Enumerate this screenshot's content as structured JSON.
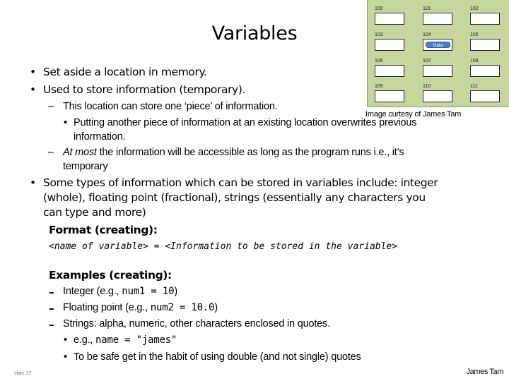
{
  "slide": {
    "title": "Variables",
    "bullets_top": [
      "Set aside a location in memory.",
      "Used to store information (temporary)."
    ],
    "sub1_a": "This location can store one ‘piece’ of information.",
    "sub1_a_child_line1": "Putting another piece of information at an existing location overwrites previous",
    "sub1_a_child_line2": "information.",
    "sub1_b_italic": "At most",
    "sub1_b_rest": " the information will be accessible as long as the program runs i.e., it’s",
    "sub1_b_line2": "temporary",
    "bullet3_line1": "Some types of information which can be stored in variables include: integer",
    "bullet3_line2": "(whole), floating point (fractional), strings (essentially any characters you",
    "bullet3_line3": "can type and more)",
    "format_heading": "Format (creating):",
    "format_syntax": "<name of variable> = <Information to be stored in the variable>",
    "examples_heading": "Examples (creating):",
    "examples": [
      {
        "prefix": "Integer (e.g., ",
        "code": "num1 = 10",
        "suffix": ")"
      },
      {
        "prefix": "Floating point (e.g., ",
        "code": "num2 = 10.0",
        "suffix": ")"
      },
      {
        "prefix": "Strings: alpha, numeric, other characters enclosed in quotes.",
        "code": "",
        "suffix": ""
      }
    ],
    "string_sub": [
      {
        "prefix": "e.g., ",
        "code": "name = \"james\""
      },
      {
        "prefix": "To be safe get in the habit of using double (and not single) quotes",
        "code": ""
      }
    ],
    "footer_left": "slide 17",
    "footer_right": "James Tam"
  },
  "memory_diagram": {
    "caption": "Image curtesy of James Tam",
    "cells": [
      "100",
      "101",
      "102",
      "103",
      "104",
      "105",
      "106",
      "107",
      "108",
      "109",
      "110",
      "111"
    ],
    "data_cell": "104",
    "data_label": "Data",
    "colors": {
      "background": "#c6d69c",
      "data_badge": "#4d7fc4"
    }
  }
}
